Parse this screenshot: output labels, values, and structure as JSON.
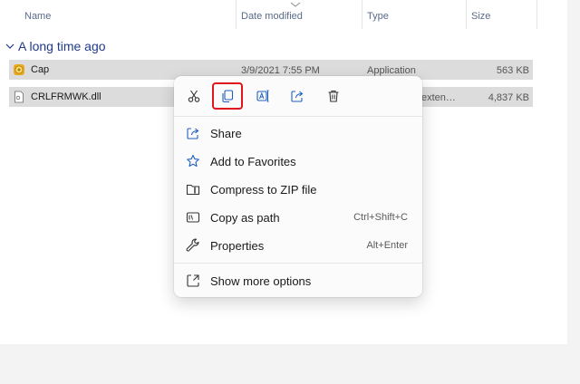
{
  "columns": {
    "name": "Name",
    "date": "Date modified",
    "type": "Type",
    "size": "Size"
  },
  "group": {
    "label": "A long time ago"
  },
  "files": [
    {
      "name": "Cap",
      "date": "3/9/2021 7:55 PM",
      "type": "Application",
      "size": "563 KB",
      "icon": "cap-app-icon"
    },
    {
      "name": "CRLFRMWK.dll",
      "date": "",
      "type": "exten…",
      "size": "4,837 KB",
      "icon": "dll-file-icon"
    }
  ],
  "context_menu": {
    "toolbar": [
      {
        "icon": "cut-icon"
      },
      {
        "icon": "copy-icon",
        "highlighted": true
      },
      {
        "icon": "rename-icon"
      },
      {
        "icon": "share-icon"
      },
      {
        "icon": "delete-icon"
      }
    ],
    "items": [
      {
        "label": "Share",
        "icon": "share-icon",
        "accel": ""
      },
      {
        "label": "Add to Favorites",
        "icon": "star-icon",
        "accel": ""
      },
      {
        "label": "Compress to ZIP file",
        "icon": "zip-icon",
        "accel": ""
      },
      {
        "label": "Copy as path",
        "icon": "copy-path-icon",
        "accel": "Ctrl+Shift+C"
      },
      {
        "label": "Properties",
        "icon": "wrench-icon",
        "accel": "Alt+Enter"
      }
    ],
    "more": {
      "label": "Show more options",
      "icon": "more-options-icon"
    }
  },
  "colors": {
    "highlight_outline": "#e0141b",
    "group_text": "#1f3a8a",
    "selected_row": "#dcdcdc"
  }
}
